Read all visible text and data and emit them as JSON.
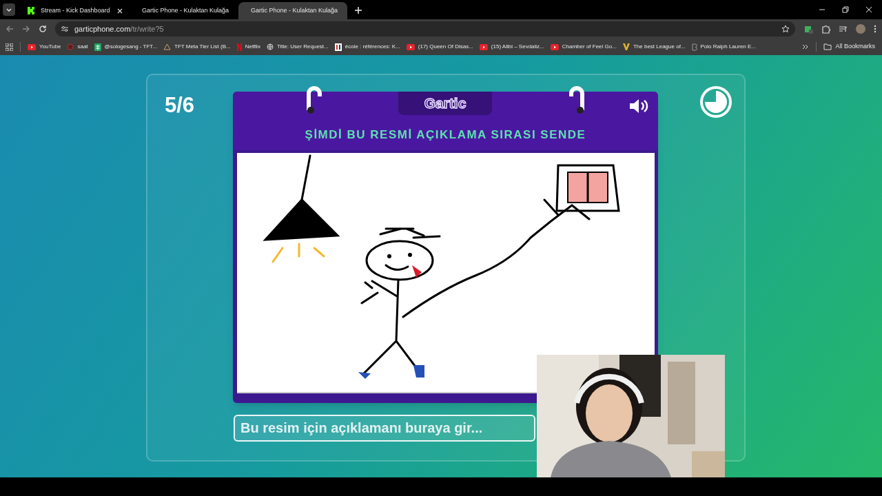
{
  "tabs": [
    {
      "title": "Stream - Kick Dashboard",
      "kind": "kick",
      "selected": false
    },
    {
      "title": "Gartic Phone - Kulaktan Kulağa",
      "kind": "gartic",
      "selected": false
    },
    {
      "title": "Gartic Phone - Kulaktan Kulağa",
      "kind": "gartic",
      "selected": true
    }
  ],
  "address": {
    "host": "garticphone.com",
    "path": "/tr/write?5"
  },
  "bookmarks": [
    {
      "label": "YouTube",
      "kind": "yt"
    },
    {
      "label": "saat",
      "kind": "dot"
    },
    {
      "label": "@sologesang - TFT...",
      "kind": "sheet"
    },
    {
      "label": "TFT Meta Tier List (B...",
      "kind": "tft"
    },
    {
      "label": "Netflix",
      "kind": "netflix"
    },
    {
      "label": "Title: User Request...",
      "kind": "globe"
    },
    {
      "label": "école : références: K...",
      "kind": "doc"
    },
    {
      "label": "(17) Queen Of Disas...",
      "kind": "yt"
    },
    {
      "label": "(15) Alibi – Sevdaliz...",
      "kind": "yt"
    },
    {
      "label": "Chamber of Feel Go...",
      "kind": "yt"
    },
    {
      "label": "The best League of...",
      "kind": "v"
    },
    {
      "label": "Polo Ralph Lauren E...",
      "kind": "polo"
    }
  ],
  "all_bookmarks": "All Bookmarks",
  "game": {
    "round": "5/6",
    "logo": "Gartic",
    "heading": "ŞİMDİ BU RESMİ AÇIKLAMA SIRASI SENDE",
    "input": {
      "placeholder": "Bu resim için açıklamanı buraya gir..."
    }
  }
}
